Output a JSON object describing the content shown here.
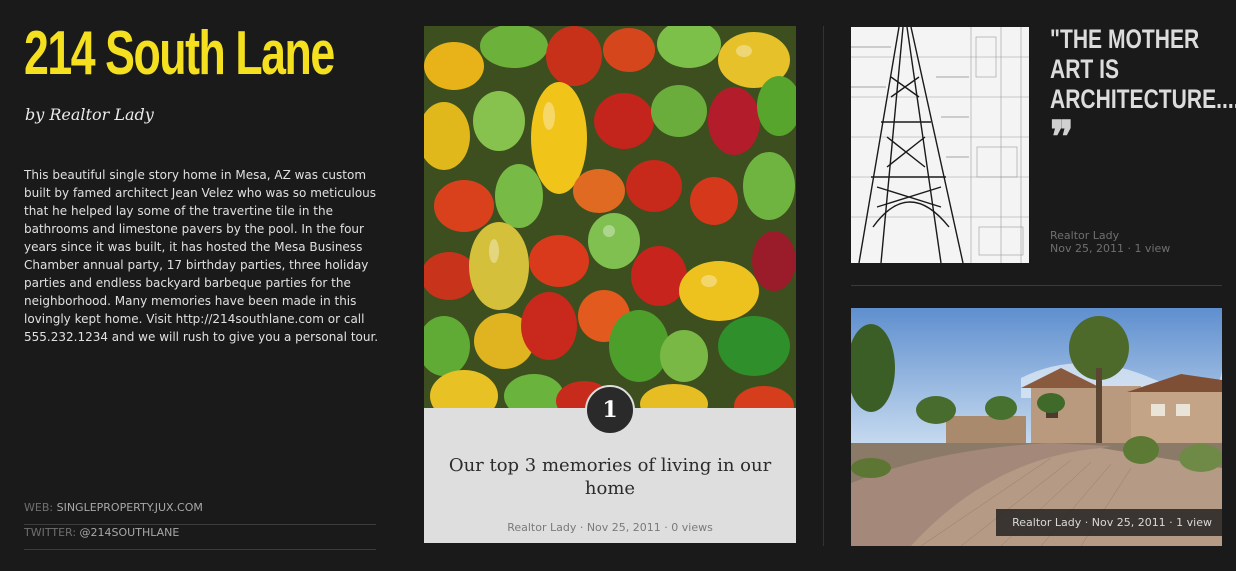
{
  "site": {
    "title": "214 South Lane",
    "byline": "by Realtor Lady"
  },
  "description": "This beautiful single story home in Mesa, AZ was custom built by famed architect Jean Velez who was so meticulous that he helped lay some of the travertine tile in the bathrooms and limestone pavers by the pool. In the four years since it was built, it has hosted the Mesa Business Chamber annual party, 17 birthday parties, three holiday parties and endless backyard barbeque parties for the neighborhood. Many memories have been made in this lovingly kept home. Visit http://214southlane.com or call 555.232.1234 and we will rush to give you a personal tour.",
  "meta": {
    "web_key": "WEB:",
    "web_value": "SINGLEPROPERTY.JUX.COM",
    "twitter_key": "TWITTER:",
    "twitter_value": "@214SOUTHLANE"
  },
  "card": {
    "number": "1",
    "title": "Our top 3 memories of living in our home",
    "meta": "Realtor Lady · Nov 25, 2011 · 0 views"
  },
  "quote": {
    "text": "\"THE MOTHER ART IS ARCHITECTURE....",
    "mark": "❞",
    "author": "Realtor Lady",
    "date_views": "Nov 25, 2011 · 1 view"
  },
  "house_post": {
    "meta": "Realtor Lady · Nov 25, 2011 · 1 view"
  },
  "colors": {
    "background": "#1a1a1a",
    "title_yellow": "#f5e020",
    "card_bg": "#dedede"
  }
}
